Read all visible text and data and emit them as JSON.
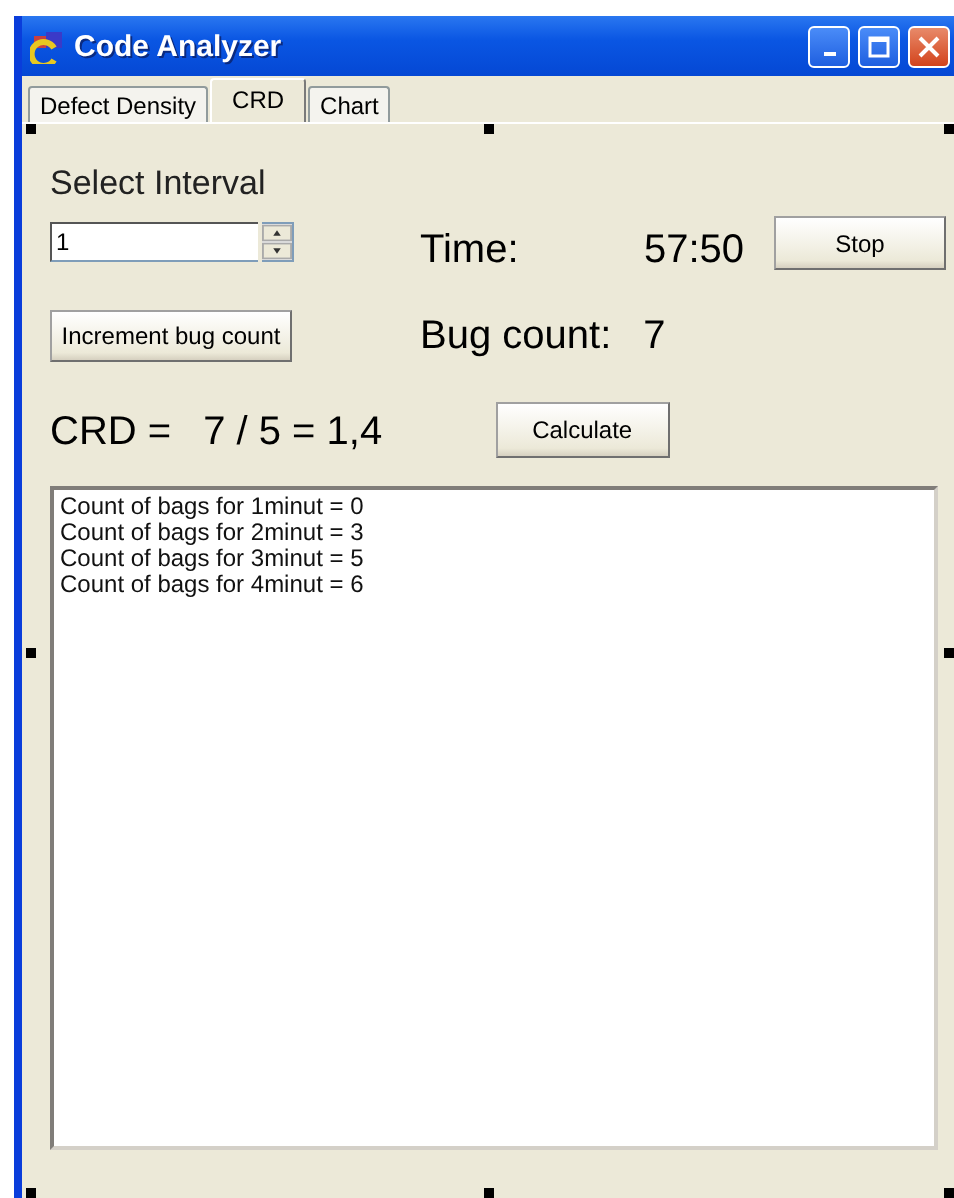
{
  "window": {
    "title": "Code Analyzer"
  },
  "tabs": [
    {
      "label": "Defect Density",
      "selected": false
    },
    {
      "label": "CRD",
      "selected": true
    },
    {
      "label": "Chart",
      "selected": false
    }
  ],
  "interval": {
    "label": "Select Interval",
    "value": "1"
  },
  "time": {
    "label": "Time:",
    "value": "57:50"
  },
  "stop_button": "Stop",
  "increment_button": "Increment bug count",
  "bug_count": {
    "label": "Bug count:",
    "value": "7"
  },
  "crd": {
    "label": "CRD =",
    "formula": "7 / 5 = 1,4"
  },
  "calculate_button": "Calculate",
  "log": [
    "Count of bags for 1minut = 0",
    "Count of bags for 2minut = 3",
    "Count of bags for 3minut = 5",
    "Count of bags for 4minut = 6"
  ]
}
